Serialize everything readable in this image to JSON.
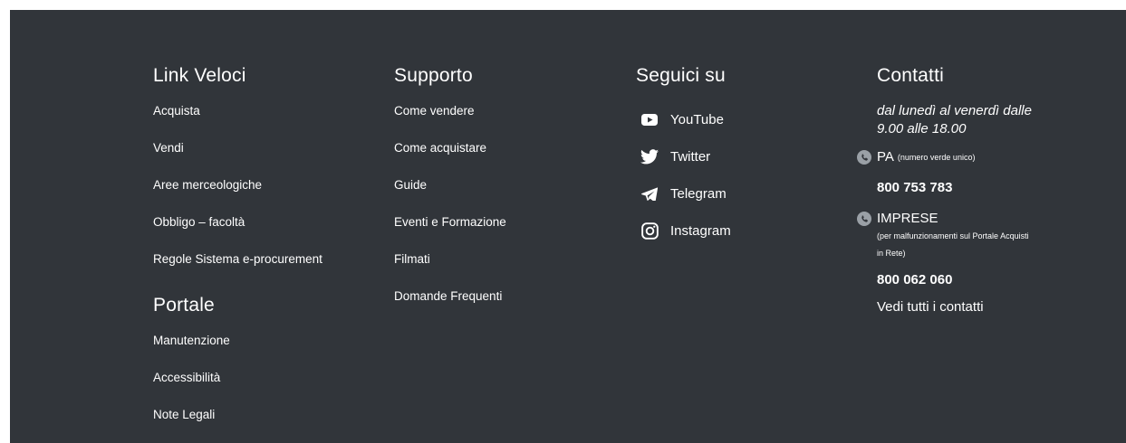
{
  "quick_links": {
    "title": "Link Veloci",
    "items": [
      "Acquista",
      "Vendi",
      "Aree merceologiche",
      "Obbligo – facoltà",
      "Regole Sistema e-procurement"
    ]
  },
  "portal": {
    "title": "Portale",
    "items": [
      "Manutenzione",
      "Accessibilità",
      "Note Legali"
    ]
  },
  "support": {
    "title": "Supporto",
    "items": [
      "Come vendere",
      "Come acquistare",
      "Guide",
      "Eventi e Formazione",
      "Filmati",
      "Domande Frequenti"
    ]
  },
  "social": {
    "title": "Seguici su",
    "items": [
      {
        "label": "YouTube",
        "icon": "youtube-icon"
      },
      {
        "label": "Twitter",
        "icon": "twitter-icon"
      },
      {
        "label": "Telegram",
        "icon": "telegram-icon"
      },
      {
        "label": "Instagram",
        "icon": "instagram-icon"
      }
    ]
  },
  "contacts": {
    "title": "Contatti",
    "hours": "dal lunedì al venerdì dalle 9.00 alle 18.00",
    "pa_label": "PA",
    "pa_note": "(numero verde unico)",
    "pa_number": "800 753 783",
    "imprese_label": "IMPRESE",
    "imprese_note": "(per malfunzionamenti sul Portale Acquisti in Rete)",
    "imprese_number": "800 062 060",
    "all_contacts": "Vedi tutti i contatti"
  },
  "colors": {
    "background": "#31353a",
    "text": "#ffffff",
    "icon_grey": "#9aa0a6"
  }
}
